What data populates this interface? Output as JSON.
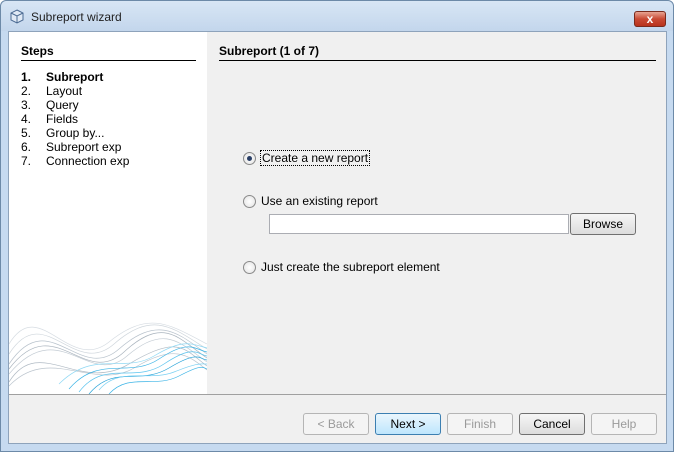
{
  "window": {
    "title": "Subreport wizard",
    "close_symbol": "x",
    "icon": "cube-icon"
  },
  "steps": {
    "header": "Steps",
    "items": [
      {
        "num": "1.",
        "label": "Subreport",
        "active": true
      },
      {
        "num": "2.",
        "label": "Layout",
        "active": false
      },
      {
        "num": "3.",
        "label": "Query",
        "active": false
      },
      {
        "num": "4.",
        "label": "Fields",
        "active": false
      },
      {
        "num": "5.",
        "label": "Group by...",
        "active": false
      },
      {
        "num": "6.",
        "label": "Subreport exp",
        "active": false
      },
      {
        "num": "7.",
        "label": "Connection exp",
        "active": false
      }
    ]
  },
  "content": {
    "header": "Subreport (1 of 7)",
    "options": {
      "create_new": {
        "label": "Create a new report",
        "checked": true
      },
      "use_existing": {
        "label": "Use an existing report",
        "checked": false
      },
      "just_create": {
        "label": "Just create the subreport element",
        "checked": false
      }
    },
    "existing_path": {
      "value": "",
      "placeholder": ""
    },
    "browse_label": "Browse"
  },
  "buttons": {
    "back": "< Back",
    "next": "Next >",
    "finish": "Finish",
    "cancel": "Cancel",
    "help": "Help"
  },
  "colors": {
    "title_bar": "#c6daf0",
    "close_button": "#c94a34",
    "default_button": "#bee6fd",
    "wave_blue": "#3cb4e6"
  }
}
